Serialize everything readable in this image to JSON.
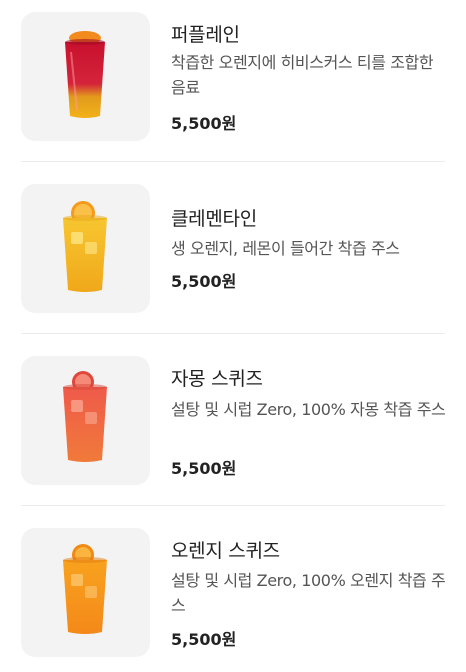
{
  "menu": {
    "items": [
      {
        "name": "퍼플레인",
        "description": "착즙한 오렌지에 히비스커스 티를 조합한 음료",
        "price": "5,500원",
        "image_icon": "purple-rain-drink-icon"
      },
      {
        "name": "클레멘타인",
        "description": "생 오렌지, 레몬이 들어간 착즙 주스",
        "price": "5,500원",
        "image_icon": "clementine-drink-icon"
      },
      {
        "name": "자몽 스퀴즈",
        "description": "설탕 및 시럽 Zero, 100% 자몽 착즙 주스",
        "price": "5,500원",
        "image_icon": "grapefruit-squeeze-drink-icon"
      },
      {
        "name": "오렌지 스퀴즈",
        "description": "설탕 및 시럽 Zero, 100% 오렌지 착즙 주스",
        "price": "5,500원",
        "image_icon": "orange-squeeze-drink-icon"
      }
    ]
  }
}
